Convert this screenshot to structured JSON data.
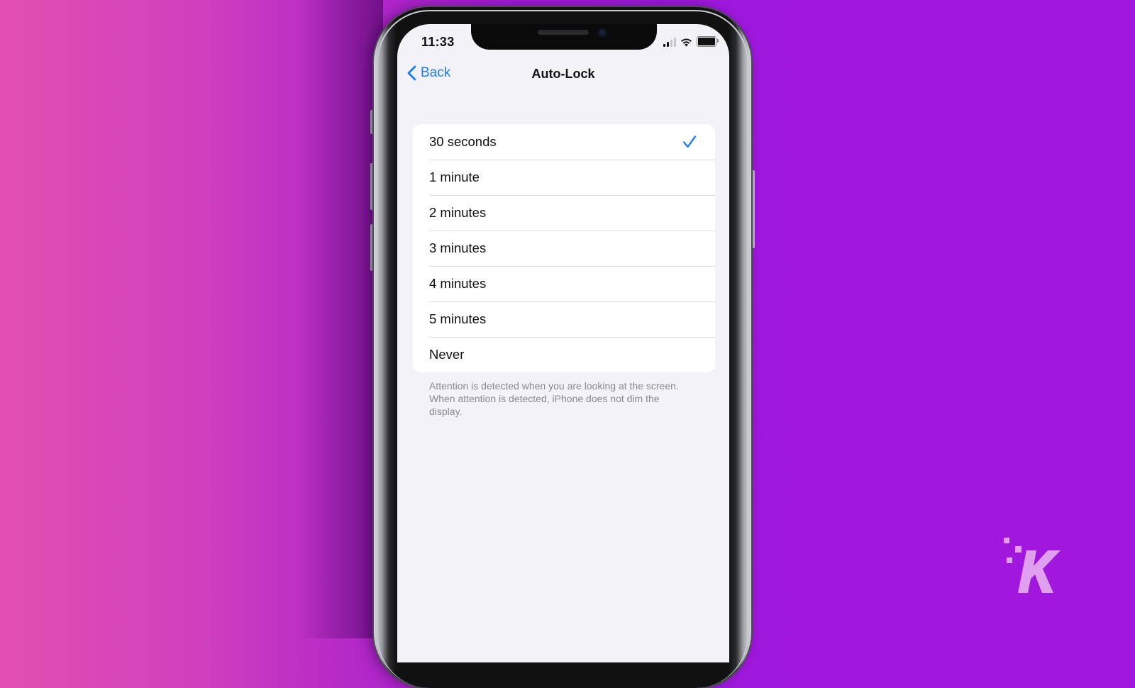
{
  "status_bar": {
    "time": "11:33",
    "signal_bars_active": 2,
    "signal_bars_total": 4,
    "wifi": "wifi-icon",
    "battery": "battery-icon"
  },
  "nav": {
    "back_label": "Back",
    "title": "Auto-Lock"
  },
  "options": [
    {
      "label": "30 seconds",
      "selected": true
    },
    {
      "label": "1 minute",
      "selected": false
    },
    {
      "label": "2 minutes",
      "selected": false
    },
    {
      "label": "3 minutes",
      "selected": false
    },
    {
      "label": "4 minutes",
      "selected": false
    },
    {
      "label": "5 minutes",
      "selected": false
    },
    {
      "label": "Never",
      "selected": false
    }
  ],
  "footer_note": "Attention is detected when you are looking at the screen. When attention is detected, iPhone does not dim the display.",
  "colors": {
    "accent": "#1a7df0",
    "background_left": "#e24fb0",
    "background_right": "#a117de",
    "logo": "#dea0ef"
  },
  "watermark": {
    "icon": "knowtechie-logo-icon",
    "letter": "K"
  }
}
